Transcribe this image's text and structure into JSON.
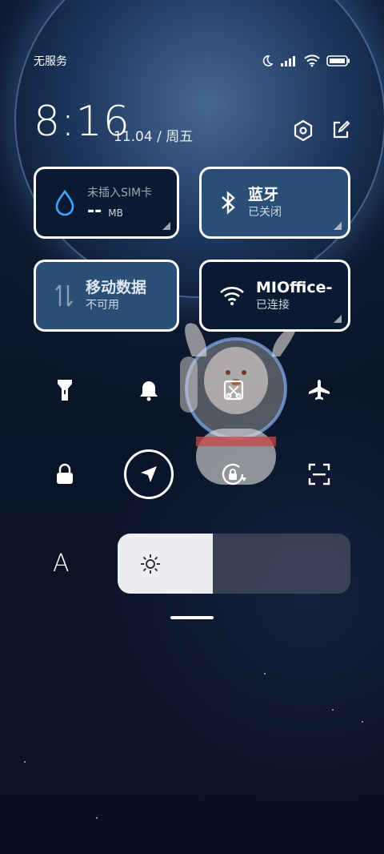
{
  "status_bar": {
    "carrier": "无服务",
    "icons": [
      "moon-icon",
      "signal-icon",
      "wifi-icon",
      "battery-icon"
    ]
  },
  "header": {
    "time": "8:16",
    "date": "11.04 / 周五",
    "settings_icon": "settings-hex-icon",
    "edit_icon": "edit-icon"
  },
  "tiles": {
    "data_usage": {
      "title": "未插入SIM卡",
      "value": "--",
      "unit": "MB",
      "icon": "water-drop-icon"
    },
    "bluetooth": {
      "title": "蓝牙",
      "status": "已关闭",
      "icon": "bluetooth-icon"
    },
    "mobile_data": {
      "title": "移动数据",
      "status": "不可用",
      "icon": "arrows-updown-icon"
    },
    "wifi": {
      "title": "MIOffice-",
      "status": "已连接",
      "icon": "wifi-icon"
    }
  },
  "toggles_row1": [
    "flashlight-icon",
    "bell-icon",
    "screenshot-icon",
    "airplane-icon"
  ],
  "toggles_row2": [
    "lock-icon",
    "location-icon",
    "rotation-lock-icon",
    "scan-icon"
  ],
  "brightness": {
    "auto_label": "A",
    "level": 0.41,
    "icon": "sun-icon"
  },
  "colors": {
    "tile_dark": "#0b1a33",
    "tile_blue": "#2a4f76",
    "accent": "#3ea5ff"
  }
}
